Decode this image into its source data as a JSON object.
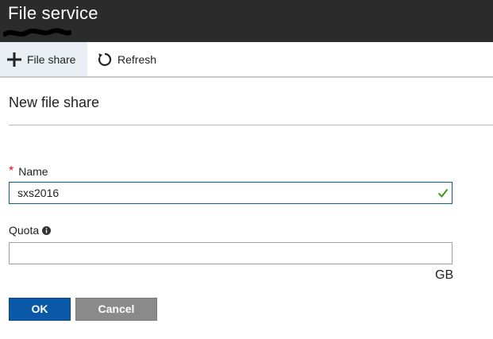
{
  "header": {
    "title": "File service"
  },
  "toolbar": {
    "file_share_label": "File share",
    "refresh_label": "Refresh"
  },
  "form": {
    "title": "New file share",
    "name": {
      "label": "Name",
      "required_marker": "*",
      "value": "sxs2016"
    },
    "quota": {
      "label": "Quota",
      "value": "",
      "unit": "GB"
    }
  },
  "buttons": {
    "ok_label": "OK",
    "cancel_label": "Cancel"
  },
  "colors": {
    "header_bg": "#2b2b2b",
    "primary": "#0a59a8",
    "secondary": "#8a8a8a",
    "valid": "#3c9a1f",
    "required": "#e00b1c"
  },
  "icons": {
    "file_share": "plus-icon",
    "refresh": "refresh-icon",
    "quota_info": "info-icon",
    "name_valid": "checkmark-icon"
  }
}
